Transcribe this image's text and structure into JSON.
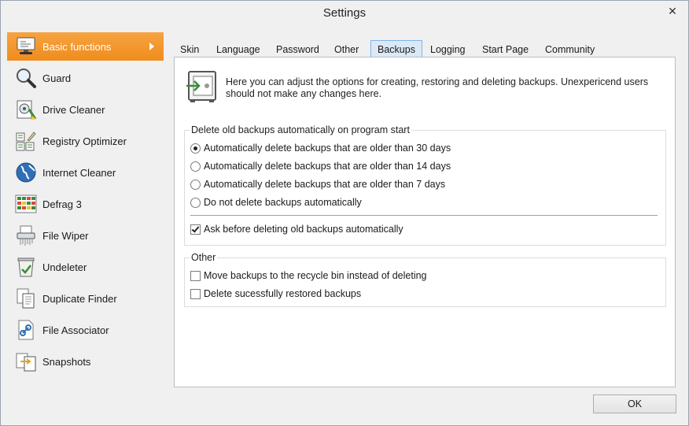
{
  "window": {
    "title": "Settings",
    "close_glyph": "✕"
  },
  "sidebar": {
    "items": [
      {
        "label": "Basic functions",
        "icon": "monitor-icon",
        "active": true
      },
      {
        "label": "Guard",
        "icon": "magnifier-icon",
        "active": false
      },
      {
        "label": "Drive Cleaner",
        "icon": "disk-cleaner-icon",
        "active": false
      },
      {
        "label": "Registry Optimizer",
        "icon": "registry-icon",
        "active": false
      },
      {
        "label": "Internet Cleaner",
        "icon": "globe-icon",
        "active": false
      },
      {
        "label": "Defrag 3",
        "icon": "defrag-grid-icon",
        "active": false
      },
      {
        "label": "File Wiper",
        "icon": "shredder-icon",
        "active": false
      },
      {
        "label": "Undeleter",
        "icon": "recycle-bin-icon",
        "active": false
      },
      {
        "label": "Duplicate Finder",
        "icon": "duplicate-docs-icon",
        "active": false
      },
      {
        "label": "File Associator",
        "icon": "file-link-icon",
        "active": false
      },
      {
        "label": "Snapshots",
        "icon": "snapshot-icon",
        "active": false
      }
    ]
  },
  "tabs": [
    {
      "label": "Skin",
      "active": false
    },
    {
      "label": "Language",
      "active": false
    },
    {
      "label": "Password",
      "active": false
    },
    {
      "label": "Other",
      "active": false
    },
    {
      "label": "Backups",
      "active": true
    },
    {
      "label": "Logging",
      "active": false
    },
    {
      "label": "Start Page",
      "active": false
    },
    {
      "label": "Community",
      "active": false
    }
  ],
  "intro": {
    "icon": "backup-safe-icon",
    "text": "Here you can adjust the options for creating, restoring and deleting backups. Unexpericend users should not make any changes here."
  },
  "delete_group": {
    "title": "Delete old backups automatically on program start",
    "options": [
      {
        "label": "Automatically delete backups that are older than 30 days",
        "selected": true
      },
      {
        "label": "Automatically delete backups that are older than 14 days",
        "selected": false
      },
      {
        "label": "Automatically delete backups that are older than 7 days",
        "selected": false
      },
      {
        "label": "Do not delete backups automatically",
        "selected": false
      }
    ],
    "ask_before": {
      "label": "Ask before deleting old backups automatically",
      "checked": true
    }
  },
  "other_group": {
    "title": "Other",
    "options": [
      {
        "label": "Move backups to the recycle bin instead of deleting",
        "checked": false
      },
      {
        "label": "Delete sucessfully restored backups",
        "checked": false
      }
    ]
  },
  "buttons": {
    "ok": "OK"
  },
  "colors": {
    "accent": "#f29420",
    "tab_active_bg": "#dbe9f7",
    "tab_active_border": "#7eb4ea",
    "brand_green": "#3c8a3c"
  }
}
